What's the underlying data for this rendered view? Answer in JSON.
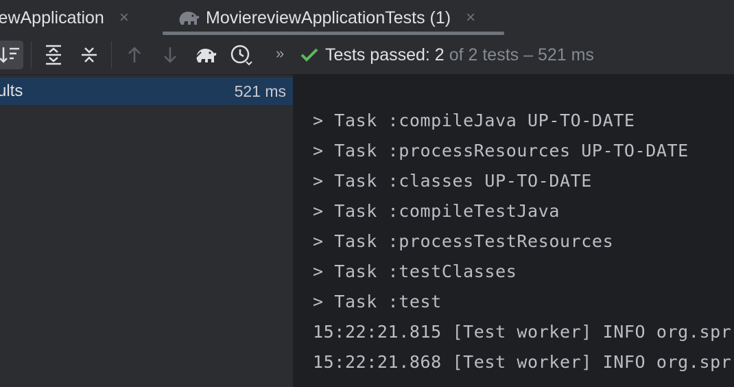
{
  "tabs": [
    {
      "label": "iewApplication",
      "close": "×"
    },
    {
      "label": "MoviereviewApplicationTests (1)",
      "close": "×",
      "icon": "gradle-elephant-icon"
    }
  ],
  "toolbar": {
    "buttons": [
      "sort-icon",
      "expand-all-icon",
      "collapse-all-icon",
      "arrow-up-icon",
      "arrow-down-icon",
      "gradle-elephant-icon",
      "history-icon"
    ],
    "more": "»",
    "status_icon": "check-icon",
    "status_passed": "Tests passed: 2",
    "status_rest": "of 2 tests – 521 ms",
    "status_color": "#5fb85f"
  },
  "tree": {
    "root_label": "ults",
    "root_time": "521 ms",
    "selected_color": "#1e3a5a"
  },
  "console": {
    "lines": [
      "> Task :compileJava UP-TO-DATE",
      "> Task :processResources UP-TO-DATE",
      "> Task :classes UP-TO-DATE",
      "> Task :compileTestJava",
      "> Task :processTestResources",
      "> Task :testClasses",
      "> Task :test",
      "15:22:21.815 [Test worker] INFO org.spr",
      "15:22:21.868 [Test worker] INFO org.spr"
    ]
  }
}
